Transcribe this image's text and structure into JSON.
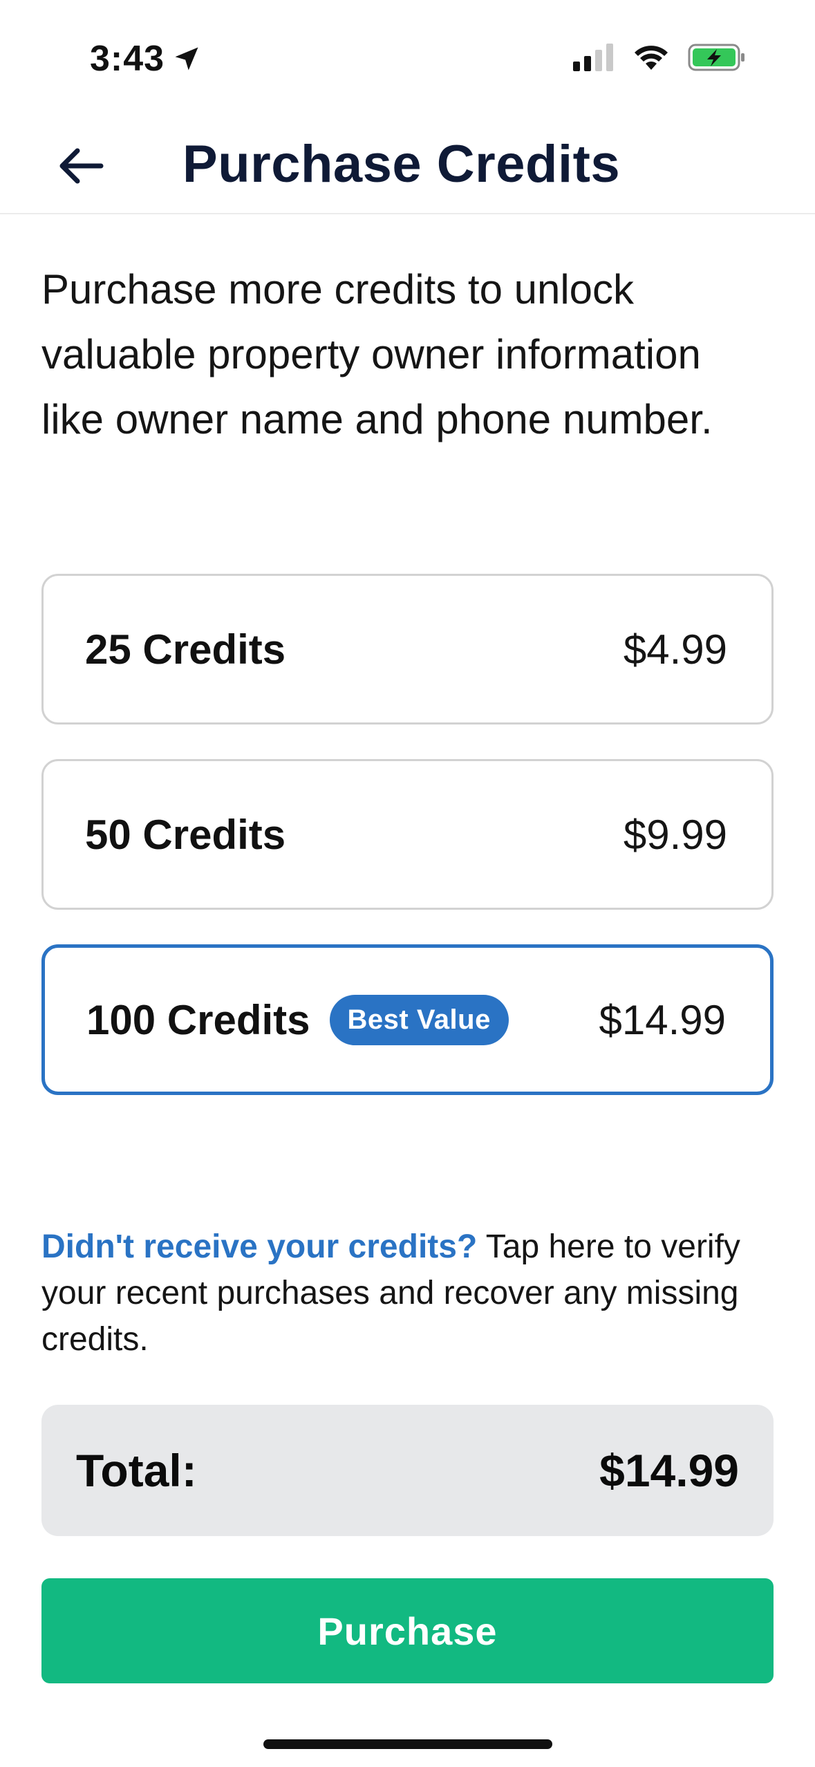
{
  "status_bar": {
    "time": "3:43",
    "icons": [
      "location-arrow-icon",
      "signal-icon",
      "wifi-icon",
      "battery-charging-icon"
    ]
  },
  "header": {
    "title": "Purchase Credits",
    "back_icon": "arrow-left-icon"
  },
  "description": "Purchase more credits to unlock valuable property owner information like owner name and phone number.",
  "options": [
    {
      "label": "25 Credits",
      "price": "$4.99",
      "badge": "",
      "selected": false
    },
    {
      "label": "50 Credits",
      "price": "$9.99",
      "badge": "",
      "selected": false
    },
    {
      "label": "100 Credits",
      "price": "$14.99",
      "badge": "Best Value",
      "selected": true
    }
  ],
  "recover": {
    "link_text": "Didn't receive your credits?",
    "body_text": " Tap here to verify your recent purchases and recover any missing credits."
  },
  "total": {
    "label": "Total:",
    "value": "$14.99"
  },
  "purchase_button": {
    "label": "Purchase"
  },
  "colors": {
    "accent": "#2a73c4",
    "primary_button": "#12b981",
    "title": "#0f1a36",
    "total_bg": "#e7e8ea",
    "battery_fill": "#34c759"
  }
}
